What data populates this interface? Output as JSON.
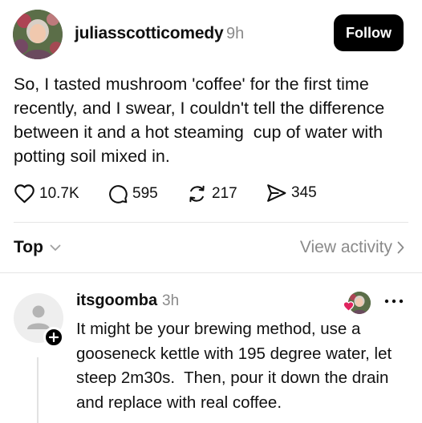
{
  "post": {
    "username": "juliasscotticomedy",
    "time": "9h",
    "follow_label": "Follow",
    "text": "So, I tasted mushroom 'coffee' for the first time recently, and I swear, I couldn't tell the difference between it and a hot steaming  cup of water with potting soil mixed in.",
    "avatar_icon": "profile-photo"
  },
  "actions": {
    "likes": "10.7K",
    "replies": "595",
    "reposts": "217",
    "shares": "345"
  },
  "sort": {
    "label": "Top",
    "view_activity": "View activity"
  },
  "reply": {
    "username": "itsgoomba",
    "time": "3h",
    "text": "It might be your brewing method, use a gooseneck kettle with 195 degree water, let steep 2m30s.  Then, pour it down the drain and replace with real coffee."
  },
  "colors": {
    "follow_bg": "#000000",
    "heart": "#e0245e",
    "muted": "#8a8a8a"
  }
}
